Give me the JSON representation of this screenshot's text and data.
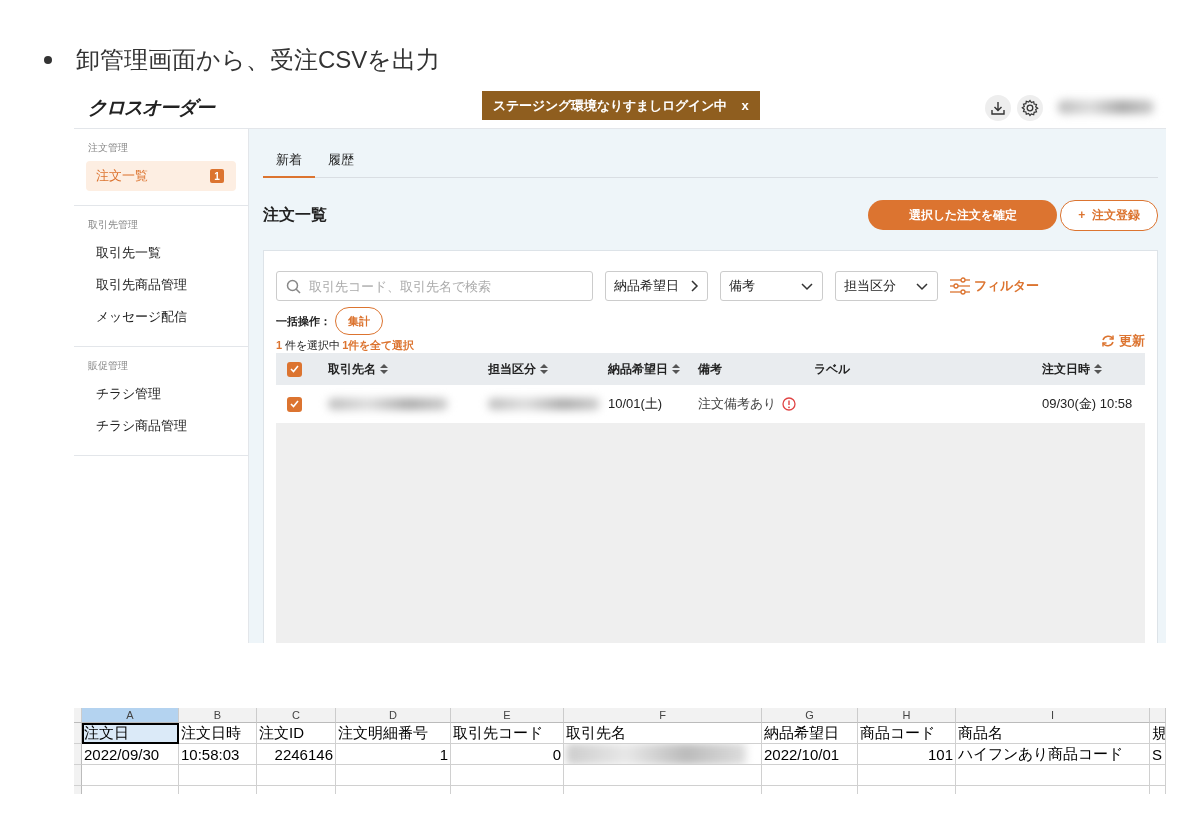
{
  "bullet": {
    "text": "卸管理画面から、受注CSVを出力"
  },
  "app": {
    "logo": "クロスオーダー",
    "banner": {
      "text": "ステージング環境なりすましログイン中",
      "close": "x"
    },
    "sidebar": [
      {
        "heading": "注文管理",
        "items": [
          {
            "label": "注文一覧",
            "selected": true,
            "badge": "1"
          }
        ]
      },
      {
        "heading": "取引先管理",
        "items": [
          {
            "label": "取引先一覧",
            "selected": false
          },
          {
            "label": "取引先商品管理",
            "selected": false
          },
          {
            "label": "メッセージ配信",
            "selected": false
          }
        ]
      },
      {
        "heading": "販促管理",
        "items": [
          {
            "label": "チラシ管理",
            "selected": false
          },
          {
            "label": "チラシ商品管理",
            "selected": false
          }
        ]
      }
    ],
    "tabs": [
      {
        "label": "新着",
        "selected": true
      },
      {
        "label": "履歴",
        "selected": false
      }
    ],
    "page_title": "注文一覧",
    "confirm_button": "選択した注文を確定",
    "add_button": {
      "icon": "+",
      "label": "注文登録"
    },
    "search": {
      "placeholder": "取引先コード、取引先名で検索"
    },
    "filters": [
      {
        "label": "納品希望日",
        "kind": "range"
      },
      {
        "label": "備考",
        "kind": "dropdown"
      },
      {
        "label": "担当区分",
        "kind": "dropdown"
      }
    ],
    "filter_link": "フィルター",
    "bulk": {
      "label": "一括操作：",
      "button": "集計"
    },
    "selection": {
      "count": "1",
      "text": "件を選択中",
      "select_all": "1件を全て選択"
    },
    "refresh": "更新",
    "table": {
      "all_checked": true,
      "columns": [
        {
          "label": "取引先名",
          "sortable": true
        },
        {
          "label": "担当区分",
          "sortable": true
        },
        {
          "label": "納品希望日",
          "sortable": true
        },
        {
          "label": "備考",
          "sortable": false
        },
        {
          "label": "ラベル",
          "sortable": false
        },
        {
          "label": "注文日時",
          "sortable": true
        }
      ],
      "rows": [
        {
          "checked": true,
          "cells": [
            {
              "kind": "redacted"
            },
            {
              "kind": "redacted"
            },
            {
              "kind": "text",
              "text": "10/01(土)"
            },
            {
              "kind": "note",
              "text": "注文備考あり"
            },
            {
              "kind": "empty"
            },
            {
              "kind": "text",
              "text": "09/30(金) 10:58"
            }
          ]
        }
      ]
    }
  },
  "sheet": {
    "columns": [
      {
        "letter": "A",
        "selected": true
      },
      {
        "letter": "B",
        "selected": false
      },
      {
        "letter": "C",
        "selected": false
      },
      {
        "letter": "D",
        "selected": false
      },
      {
        "letter": "E",
        "selected": false
      },
      {
        "letter": "F",
        "selected": false
      },
      {
        "letter": "G",
        "selected": false
      },
      {
        "letter": "H",
        "selected": false
      },
      {
        "letter": "I",
        "selected": false
      },
      {
        "selected": false
      }
    ],
    "rows": [
      {
        "cells": [
          {
            "kind": "text",
            "text": "注文日",
            "selected": true
          },
          {
            "kind": "text",
            "text": "注文日時",
            "selected": false
          },
          {
            "kind": "text",
            "text": "注文ID",
            "selected": false
          },
          {
            "kind": "text",
            "text": "注文明細番号",
            "selected": false
          },
          {
            "kind": "text",
            "text": "取引先コード",
            "selected": false
          },
          {
            "kind": "text",
            "text": "取引先名",
            "selected": false
          },
          {
            "kind": "text",
            "text": "納品希望日",
            "selected": false
          },
          {
            "kind": "text",
            "text": "商品コード",
            "selected": false
          },
          {
            "kind": "text",
            "text": "商品名",
            "selected": false
          },
          {
            "kind": "text",
            "text": "規",
            "selected": false
          }
        ]
      },
      {
        "cells": [
          {
            "kind": "text",
            "text": "2022/09/30",
            "selected": false
          },
          {
            "kind": "text",
            "text": "10:58:03",
            "selected": false
          },
          {
            "kind": "number",
            "text": "2246146",
            "selected": false
          },
          {
            "kind": "number",
            "text": "1",
            "selected": false
          },
          {
            "kind": "number",
            "text": "0",
            "selected": false
          },
          {
            "kind": "redacted",
            "selected": false
          },
          {
            "kind": "text",
            "text": "2022/10/01",
            "selected": false
          },
          {
            "kind": "number",
            "text": "101",
            "selected": false
          },
          {
            "kind": "text",
            "text": "ハイフンあり商品コード",
            "selected": false
          },
          {
            "kind": "text",
            "text": "S",
            "selected": false
          }
        ]
      }
    ]
  }
}
